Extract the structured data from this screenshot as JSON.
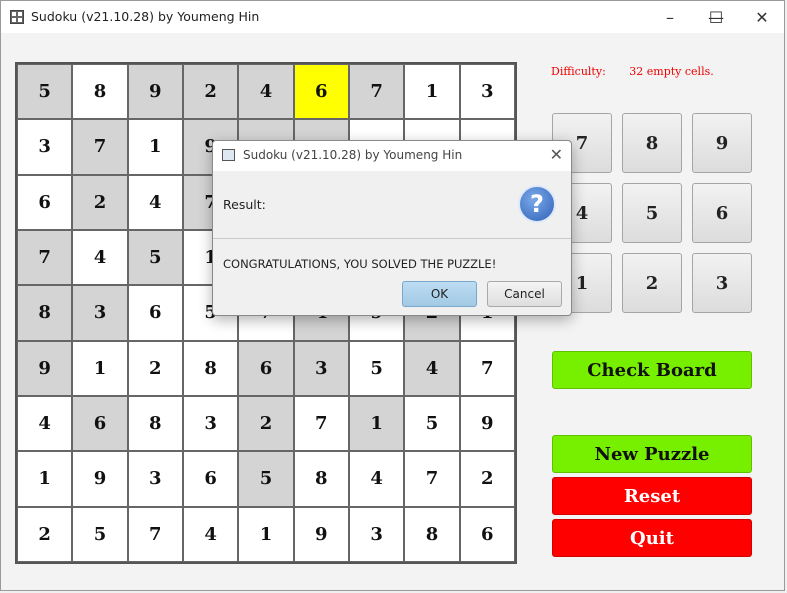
{
  "window": {
    "title": "Sudoku (v21.10.28) by Youmeng Hin"
  },
  "board": {
    "cells": [
      [
        "5",
        "8",
        "9",
        "2",
        "4",
        "6",
        "7",
        "1",
        "3"
      ],
      [
        "3",
        "7",
        "1",
        "9",
        "",
        "",
        "",
        "",
        ""
      ],
      [
        "6",
        "2",
        "4",
        "7",
        "",
        "",
        "",
        "",
        ""
      ],
      [
        "7",
        "4",
        "5",
        "1",
        "",
        "",
        "",
        "",
        ""
      ],
      [
        "8",
        "3",
        "6",
        "5",
        "7",
        "4",
        "9",
        "2",
        "1"
      ],
      [
        "9",
        "1",
        "2",
        "8",
        "6",
        "3",
        "5",
        "4",
        "7"
      ],
      [
        "4",
        "6",
        "8",
        "3",
        "2",
        "7",
        "1",
        "5",
        "9"
      ],
      [
        "1",
        "9",
        "3",
        "6",
        "5",
        "8",
        "4",
        "7",
        "2"
      ],
      [
        "2",
        "5",
        "7",
        "4",
        "1",
        "9",
        "3",
        "8",
        "6"
      ]
    ],
    "given": [
      [
        1,
        0,
        1,
        1,
        1,
        0,
        1,
        0,
        0
      ],
      [
        0,
        1,
        0,
        1,
        1,
        1,
        0,
        0,
        0
      ],
      [
        0,
        1,
        0,
        1,
        1,
        1,
        0,
        0,
        0
      ],
      [
        1,
        0,
        1,
        0,
        0,
        0,
        1,
        0,
        1
      ],
      [
        1,
        1,
        0,
        0,
        0,
        1,
        0,
        1,
        0
      ],
      [
        1,
        0,
        0,
        0,
        1,
        1,
        0,
        1,
        0
      ],
      [
        0,
        1,
        0,
        0,
        1,
        0,
        1,
        0,
        0
      ],
      [
        0,
        0,
        0,
        0,
        1,
        0,
        0,
        0,
        0
      ],
      [
        0,
        0,
        0,
        0,
        0,
        0,
        0,
        0,
        0
      ]
    ],
    "selected": {
      "row": 0,
      "col": 5
    },
    "colors": {
      "given": "#d4d4d4",
      "selected": "#ffff00"
    }
  },
  "info": {
    "difficulty_label": "Difficulty:",
    "empty_cells": "32 empty cells."
  },
  "numpad": [
    "7",
    "8",
    "9",
    "4",
    "5",
    "6",
    "1",
    "2",
    "3"
  ],
  "buttons": {
    "check": "Check Board",
    "new_puzzle": "New Puzzle",
    "reset": "Reset",
    "quit": "Quit"
  },
  "dialog": {
    "title": "Sudoku (v21.10.28) by Youmeng Hin",
    "result_label": "Result:",
    "message": "CONGRATULATIONS, YOU SOLVED THE PUZZLE!",
    "ok": "OK",
    "cancel": "Cancel",
    "icon": "question-icon"
  }
}
